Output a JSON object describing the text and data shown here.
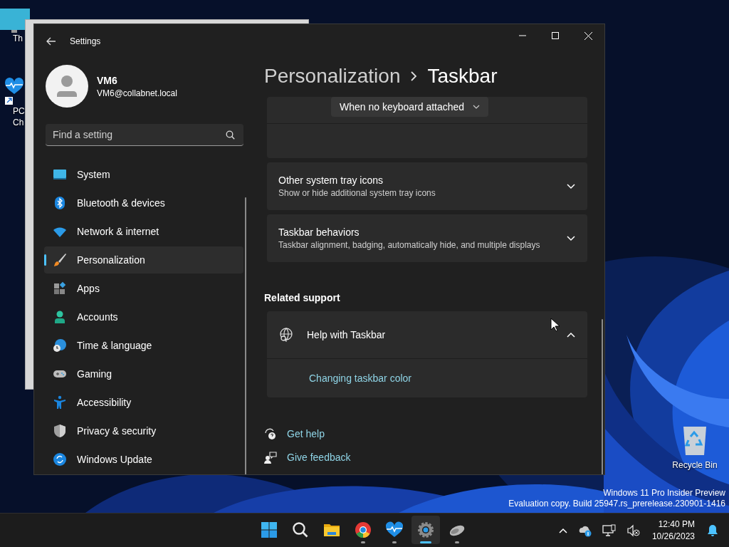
{
  "desktop_icons": [
    {
      "kind": "monitor",
      "lines": [
        "Th"
      ]
    },
    {
      "kind": "health",
      "lines": [
        "PC",
        "Ch"
      ]
    }
  ],
  "recycle_bin": {
    "label": "Recycle Bin"
  },
  "settings_window": {
    "title": "Settings",
    "user": {
      "name": "VM6",
      "email": "VM6@collabnet.local"
    },
    "search": {
      "placeholder": "Find a setting"
    },
    "nav": [
      {
        "label": "System",
        "kind": "system",
        "selected": false
      },
      {
        "label": "Bluetooth & devices",
        "kind": "bluetooth",
        "selected": false
      },
      {
        "label": "Network & internet",
        "kind": "wifi",
        "selected": false
      },
      {
        "label": "Personalization",
        "kind": "brush",
        "selected": true
      },
      {
        "label": "Apps",
        "kind": "apps",
        "selected": false
      },
      {
        "label": "Accounts",
        "kind": "person",
        "selected": false
      },
      {
        "label": "Time & language",
        "kind": "clock",
        "selected": false
      },
      {
        "label": "Gaming",
        "kind": "gamepad",
        "selected": false
      },
      {
        "label": "Accessibility",
        "kind": "accessibility",
        "selected": false
      },
      {
        "label": "Privacy & security",
        "kind": "shield",
        "selected": false
      },
      {
        "label": "Windows Update",
        "kind": "update",
        "selected": false
      }
    ],
    "breadcrumb": [
      "Personalization",
      "Taskbar"
    ],
    "dropdown": {
      "value": "When no keyboard attached"
    },
    "cards": [
      {
        "title": "Other system tray icons",
        "subtitle": "Show or hide additional system tray icons",
        "expanded": false
      },
      {
        "title": "Taskbar behaviors",
        "subtitle": "Taskbar alignment, badging, automatically hide, and multiple displays",
        "expanded": false
      }
    ],
    "related_heading": "Related support",
    "help": {
      "title": "Help with Taskbar",
      "expanded": true,
      "links": [
        "Changing taskbar color"
      ]
    },
    "footer_links": [
      {
        "label": "Get help",
        "kind": "help"
      },
      {
        "label": "Give feedback",
        "kind": "feedback"
      }
    ]
  },
  "build_notice": [
    "Windows 11 Pro Insider Preview",
    "Evaluation copy. Build 25947.rs_prerelease.230901-1416"
  ],
  "taskbar": {
    "apps": [
      {
        "kind": "start",
        "running": false,
        "active": false
      },
      {
        "kind": "search",
        "running": false,
        "active": false
      },
      {
        "kind": "folder",
        "running": false,
        "active": false
      },
      {
        "kind": "browser",
        "running": true,
        "active": false
      },
      {
        "kind": "health",
        "running": true,
        "active": false
      },
      {
        "kind": "settings",
        "running": true,
        "active": true
      },
      {
        "kind": "mouse",
        "running": true,
        "active": false
      }
    ],
    "clock": {
      "time": "12:40 PM",
      "date": "10/26/2023"
    }
  }
}
